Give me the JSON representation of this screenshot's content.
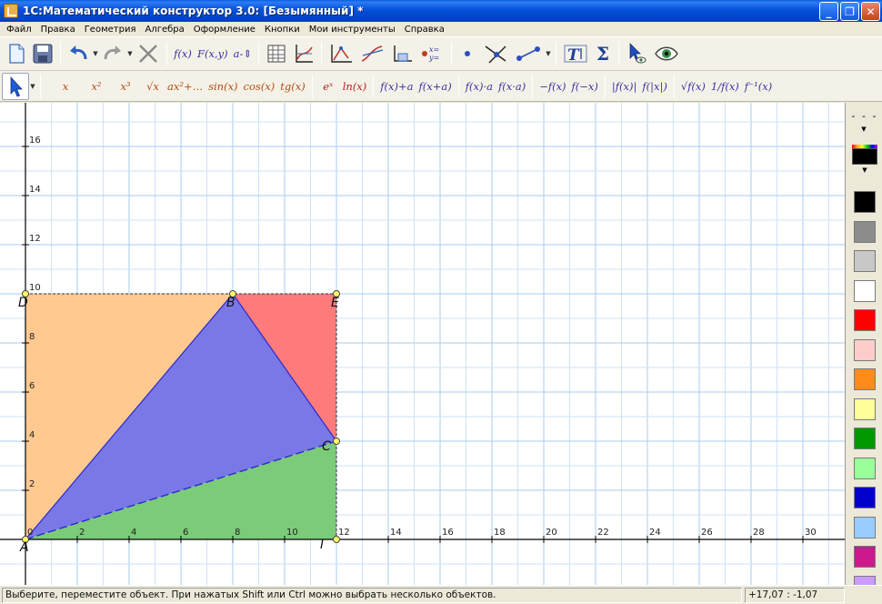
{
  "window": {
    "title": "1С:Математический конструктор 3.0: [Безымянный] *",
    "min": "_",
    "max": "❐",
    "close": "✕"
  },
  "menu": [
    "Файл",
    "Правка",
    "Геометрия",
    "Алгебра",
    "Оформление",
    "Кнопки",
    "Мои инструменты",
    "Справка"
  ],
  "toolbar1": {
    "fx": "f(x)",
    "Fxy": "F(x,y)",
    "a": "a-",
    "sigma": "Σ",
    "text_tool": "T|"
  },
  "toolbar2": {
    "x": "x",
    "x2": "x²",
    "x3": "x³",
    "sqrt": "√x",
    "ax": "ax²+…",
    "sin": "sin(x)",
    "cos": "cos(x)",
    "tg": "tg(x)",
    "exp": "eˣ",
    "ln": "ln(x)",
    "shift_up": "f(x)+a",
    "shift_in": "f(x+a)",
    "scale_out": "f(x)·a",
    "scale_in": "f(x·a)",
    "neg_out": "−f(x)",
    "neg_in": "f(−x)",
    "abs_out": "|f(x)|",
    "abs_in": "f(|x|)",
    "sqrt_f": "√f(x)",
    "recip": "1/f(x)",
    "inverse": "f⁻¹(x)"
  },
  "axes": {
    "x_ticks": [
      "2",
      "4",
      "6",
      "8",
      "10",
      "12",
      "14",
      "16",
      "18",
      "20",
      "22",
      "24",
      "26",
      "28",
      "30"
    ],
    "y_ticks": [
      "2",
      "4",
      "6",
      "8",
      "10",
      "12",
      "14",
      "16"
    ],
    "origin": "0"
  },
  "points": [
    {
      "label": "A",
      "x": 0,
      "y": 0
    },
    {
      "label": "B",
      "x": 8,
      "y": 10
    },
    {
      "label": "C",
      "x": 12,
      "y": 4
    },
    {
      "label": "D",
      "x": 0,
      "y": 10
    },
    {
      "label": "E",
      "x": 12,
      "y": 10
    },
    {
      "label": "Г",
      "x": 12,
      "y": 0
    }
  ],
  "polygons": [
    {
      "name": "orange-triangle",
      "color": "#ffc990",
      "vertices": [
        "A",
        "D",
        "B"
      ]
    },
    {
      "name": "red-triangle",
      "color": "#ff7a7a",
      "vertices": [
        "B",
        "E",
        "C"
      ]
    },
    {
      "name": "green-triangle",
      "color": "#7ccb78",
      "vertices": [
        "A",
        "C",
        "Г"
      ]
    },
    {
      "name": "blue-triangle",
      "color": "#7a78e6",
      "vertices": [
        "A",
        "B",
        "C"
      ]
    }
  ],
  "line_style": "- - -",
  "palette": [
    "#000000",
    "#8c8c8c",
    "#c8c8c8",
    "#ffffff",
    "#ff0000",
    "#ffcccc",
    "#ff8c1a",
    "#ffff99",
    "#009900",
    "#99ff99",
    "#0000cc",
    "#99ccff",
    "#cc1a8c",
    "#cc99ff"
  ],
  "status": {
    "message": "Выберите, переместите объект. При нажатых Shift или Ctrl можно выбрать несколько объектов.",
    "coords": "+17,07 : -1,07"
  }
}
